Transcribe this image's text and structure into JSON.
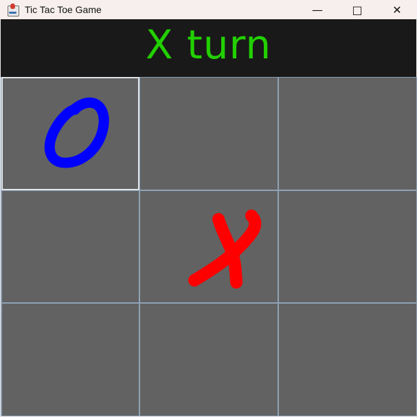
{
  "window": {
    "title": "Tic Tac Toe Game",
    "controls": {
      "minimize": "—",
      "maximize": "□",
      "close": "✕"
    }
  },
  "game": {
    "turn_text": "X turn",
    "active_cell": 0,
    "cells": [
      "O",
      "",
      "",
      "",
      "X",
      "",
      "",
      "",
      ""
    ],
    "colors": {
      "header_bg": "#191919",
      "turn_text": "#22d000",
      "board_bg": "#626262",
      "grid_line": "#8ea3b6",
      "x_mark": "#ff0000",
      "o_mark": "#0000ff"
    }
  }
}
